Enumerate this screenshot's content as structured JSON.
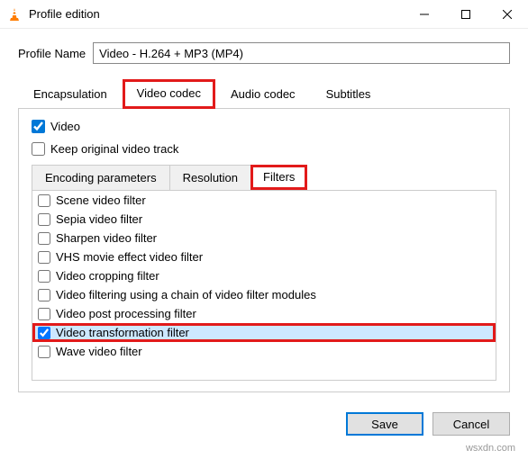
{
  "window": {
    "title": "Profile edition"
  },
  "profile": {
    "label": "Profile Name",
    "value": "Video - H.264 + MP3 (MP4)"
  },
  "mainTabs": {
    "encapsulation": "Encapsulation",
    "videoCodec": "Video codec",
    "audioCodec": "Audio codec",
    "subtitles": "Subtitles"
  },
  "options": {
    "video": "Video",
    "keepOriginal": "Keep original video track"
  },
  "subTabs": {
    "encoding": "Encoding parameters",
    "resolution": "Resolution",
    "filters": "Filters"
  },
  "filters": [
    {
      "label": "Scene video filter",
      "checked": false,
      "selected": false
    },
    {
      "label": "Sepia video filter",
      "checked": false,
      "selected": false
    },
    {
      "label": "Sharpen video filter",
      "checked": false,
      "selected": false
    },
    {
      "label": "VHS movie effect video filter",
      "checked": false,
      "selected": false
    },
    {
      "label": "Video cropping filter",
      "checked": false,
      "selected": false
    },
    {
      "label": "Video filtering using a chain of video filter modules",
      "checked": false,
      "selected": false
    },
    {
      "label": "Video post processing filter",
      "checked": false,
      "selected": false
    },
    {
      "label": "Video transformation filter",
      "checked": true,
      "selected": true
    },
    {
      "label": "Wave video filter",
      "checked": false,
      "selected": false
    }
  ],
  "buttons": {
    "save": "Save",
    "cancel": "Cancel"
  },
  "watermark": "wsxdn.com"
}
